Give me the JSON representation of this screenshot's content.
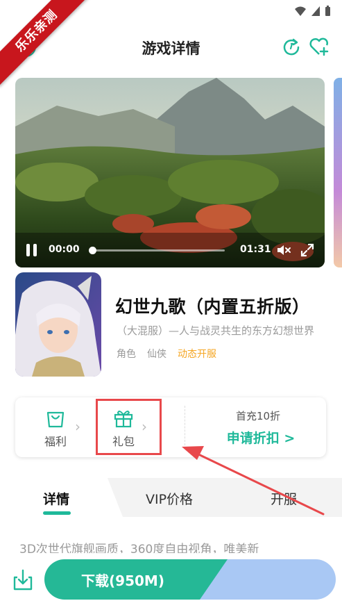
{
  "watermark": "乐乐亲测",
  "header": {
    "title": "游戏详情"
  },
  "video": {
    "current_time": "00:00",
    "total_time": "01:31",
    "progress": 0.0
  },
  "app": {
    "name": "幻世九歌（内置五折版）",
    "description": "（大混服）—人与战灵共生的东方幻想世界",
    "tags": [
      {
        "label": "角色",
        "accent": false
      },
      {
        "label": "仙侠",
        "accent": false
      },
      {
        "label": "动态开服",
        "accent": true
      }
    ]
  },
  "actions": {
    "welfare_label": "福利",
    "gift_label": "礼包",
    "promo_sub": "首充10折",
    "promo_main": "申请折扣 >"
  },
  "tabs": [
    {
      "label": "详情",
      "active": true
    },
    {
      "label": "VIP价格",
      "active": false
    },
    {
      "label": "开服",
      "active": false
    }
  ],
  "preview_text": "3D次世代旗舰画质，360度自由视角，唯美新",
  "bottom": {
    "download_label": "下载(950M)"
  },
  "colors": {
    "accent": "#1fb99a",
    "tag_accent": "#f5a623",
    "annotation": "#e8484b",
    "ribbon": "#c8161d"
  }
}
